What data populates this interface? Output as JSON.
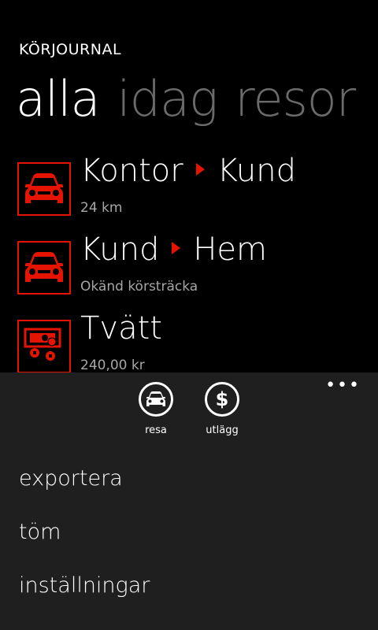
{
  "header": {
    "app_title": "KÖRJOURNAL"
  },
  "pivot": {
    "items": [
      {
        "label": "alla",
        "active": true
      },
      {
        "label": "idag",
        "active": false
      },
      {
        "label": "resor",
        "active": false
      }
    ]
  },
  "list": {
    "items": [
      {
        "from": "Kontor",
        "to": "Kund",
        "subtitle": "24 km",
        "icon": "car-icon"
      },
      {
        "from": "Kund",
        "to": "Hem",
        "subtitle": "Okänd körsträcka",
        "icon": "car-icon"
      },
      {
        "title": "Tvätt",
        "subtitle": "240,00 kr",
        "icon": "money-icon"
      }
    ]
  },
  "appbar": {
    "ellipsis": "•••",
    "buttons": [
      {
        "label": "resa",
        "icon": "car-icon"
      },
      {
        "label": "utlägg",
        "icon": "dollar-icon",
        "glyph": "$"
      }
    ],
    "menu_items": [
      "exportera",
      "töm",
      "inställningar"
    ]
  },
  "colors": {
    "accent": "#e51400",
    "background": "#000000",
    "appbar": "#1f1f1f",
    "inactive_text": "#6b6b6b",
    "subtitle_text": "#a6a6a6"
  }
}
